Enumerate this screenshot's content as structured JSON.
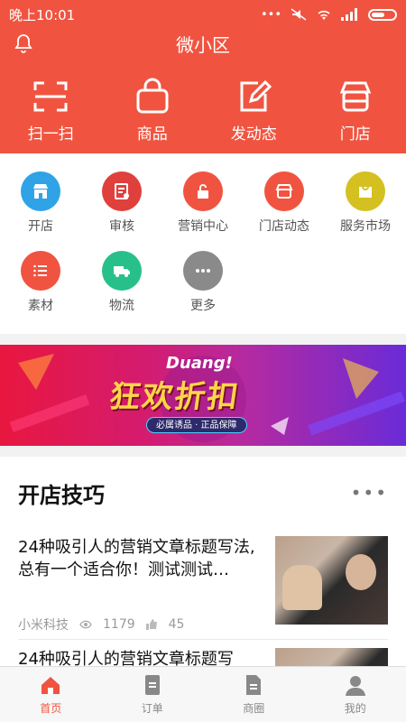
{
  "status_bar": {
    "time": "晚上10:01",
    "dots": "•••"
  },
  "header": {
    "title": "微小区"
  },
  "quick_actions": [
    {
      "label": "扫一扫",
      "icon": "scan-icon"
    },
    {
      "label": "商品",
      "icon": "shopping-bag-icon"
    },
    {
      "label": "发动态",
      "icon": "edit-post-icon"
    },
    {
      "label": "门店",
      "icon": "storefront-icon"
    }
  ],
  "grid_items": [
    {
      "label": "开店",
      "icon": "open-store-icon",
      "color": "#2fa3e6"
    },
    {
      "label": "审核",
      "icon": "review-icon",
      "color": "#e0403c"
    },
    {
      "label": "营销中心",
      "icon": "marketing-lock-icon",
      "color": "#f05440"
    },
    {
      "label": "门店动态",
      "icon": "store-news-icon",
      "color": "#f05440"
    },
    {
      "label": "服务市场",
      "icon": "service-market-icon",
      "color": "#d4c020"
    },
    {
      "label": "素材",
      "icon": "materials-list-icon",
      "color": "#f05440"
    },
    {
      "label": "物流",
      "icon": "truck-icon",
      "color": "#28c08a"
    },
    {
      "label": "更多",
      "icon": "more-icon",
      "color": "#8a8a8a"
    }
  ],
  "banner": {
    "title": "狂欢折扣",
    "subtitle": "Duang!",
    "tag": "必属诱品 · 正品保障"
  },
  "section": {
    "title": "开店技巧",
    "more": "•••",
    "articles": [
      {
        "headline": "24种吸引人的营销文章标题写法,总有一个适合你！测试测试…",
        "source": "小米科技",
        "views": "1179",
        "likes": "45"
      },
      {
        "headline": "24种吸引人的营销文章标题写",
        "source": "",
        "views": "",
        "likes": ""
      }
    ]
  },
  "bottom_nav": [
    {
      "label": "首页",
      "icon": "home-icon",
      "active": true
    },
    {
      "label": "订单",
      "icon": "orders-icon",
      "active": false
    },
    {
      "label": "商圈",
      "icon": "business-circle-icon",
      "active": false
    },
    {
      "label": "我的",
      "icon": "profile-icon",
      "active": false
    }
  ],
  "colors": {
    "brand": "#f05440",
    "active_nav": "#f05440"
  }
}
